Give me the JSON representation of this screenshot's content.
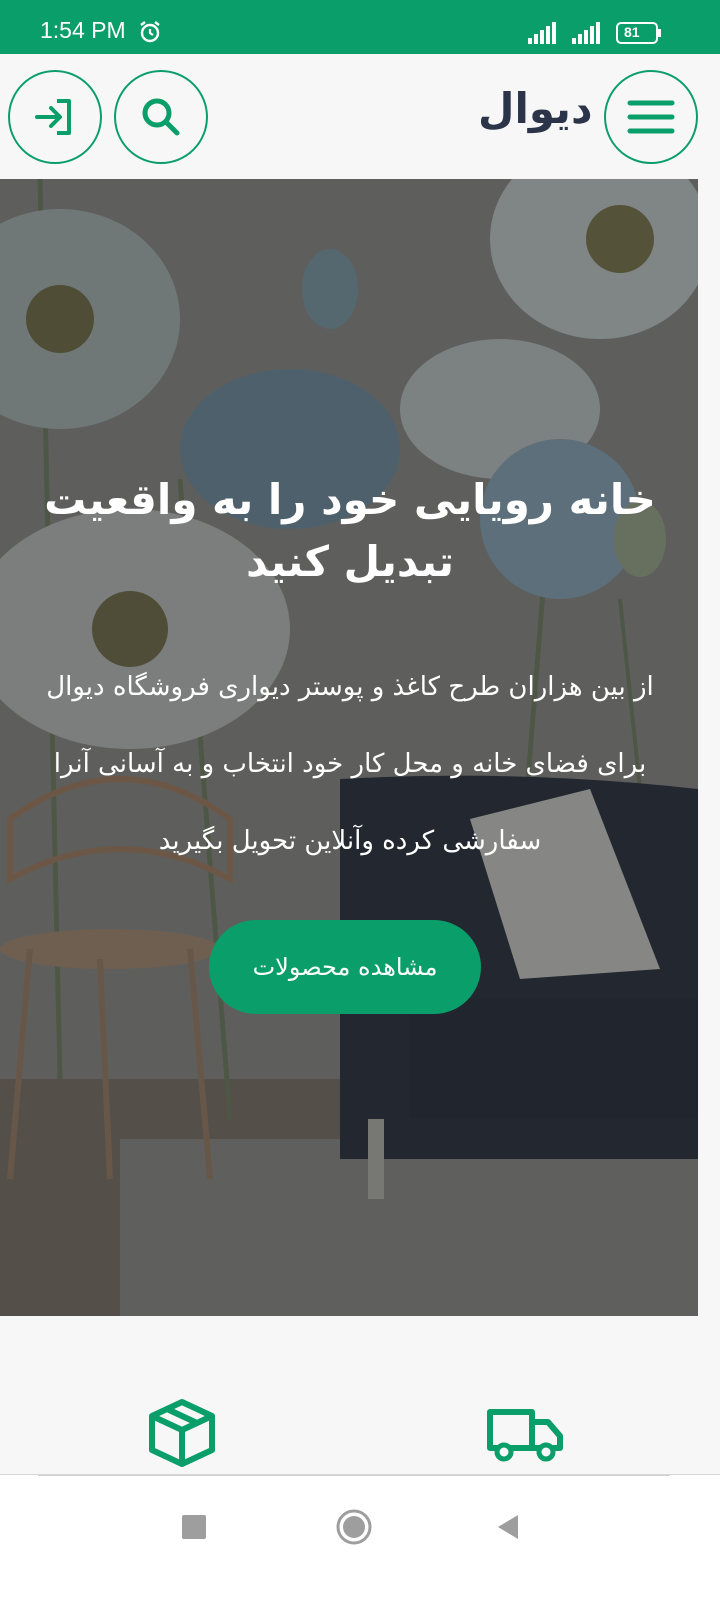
{
  "status": {
    "time": "1:54 PM",
    "battery": "81"
  },
  "header": {
    "logo": "دیوال",
    "icons": [
      "login-icon",
      "search-icon",
      "menu-icon"
    ]
  },
  "hero": {
    "title": "خانه رویایی خود را به واقعیت تبدیل کنید",
    "description": "از بین هزاران طرح کاغذ و پوستر دیواری فروشگاه دیوال برای فضای خانه و محل کار خود انتخاب و به آسانی آنرا سفارشی کرده وآنلاین تحویل بگیرید",
    "cta": "مشاهده محصولات"
  },
  "features": {
    "icons": [
      "box-icon",
      "truck-icon"
    ]
  },
  "colors": {
    "accent": "#0a9e6b",
    "logo": "#2b3448"
  }
}
